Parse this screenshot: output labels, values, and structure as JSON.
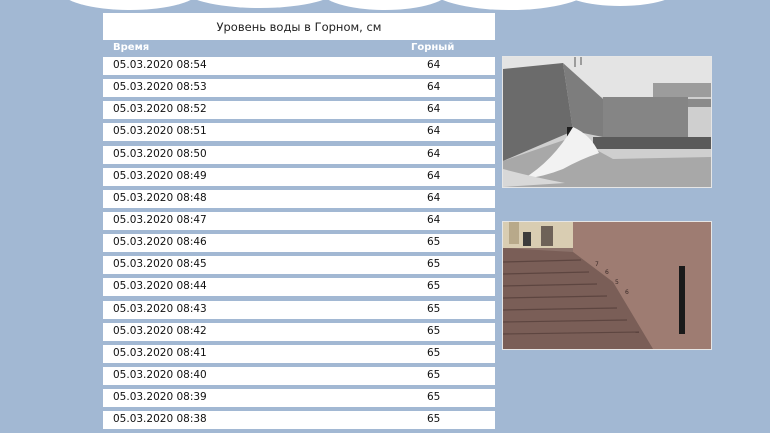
{
  "table": {
    "title": "Уровень воды в Горном, см",
    "col_time": "Время",
    "col_level": "Горный",
    "rows": [
      {
        "time": "05.03.2020 08:54",
        "level": "64"
      },
      {
        "time": "05.03.2020 08:53",
        "level": "64"
      },
      {
        "time": "05.03.2020 08:52",
        "level": "64"
      },
      {
        "time": "05.03.2020 08:51",
        "level": "64"
      },
      {
        "time": "05.03.2020 08:50",
        "level": "64"
      },
      {
        "time": "05.03.2020 08:49",
        "level": "64"
      },
      {
        "time": "05.03.2020 08:48",
        "level": "64"
      },
      {
        "time": "05.03.2020 08:47",
        "level": "64"
      },
      {
        "time": "05.03.2020 08:46",
        "level": "65"
      },
      {
        "time": "05.03.2020 08:45",
        "level": "65"
      },
      {
        "time": "05.03.2020 08:44",
        "level": "65"
      },
      {
        "time": "05.03.2020 08:43",
        "level": "65"
      },
      {
        "time": "05.03.2020 08:42",
        "level": "65"
      },
      {
        "time": "05.03.2020 08:41",
        "level": "65"
      },
      {
        "time": "05.03.2020 08:40",
        "level": "65"
      },
      {
        "time": "05.03.2020 08:39",
        "level": "65"
      },
      {
        "time": "05.03.2020 08:38",
        "level": "65"
      }
    ]
  },
  "colors": {
    "background": "#a2b8d3",
    "row_background": "#ffffff",
    "header_text": "#ffffff"
  }
}
